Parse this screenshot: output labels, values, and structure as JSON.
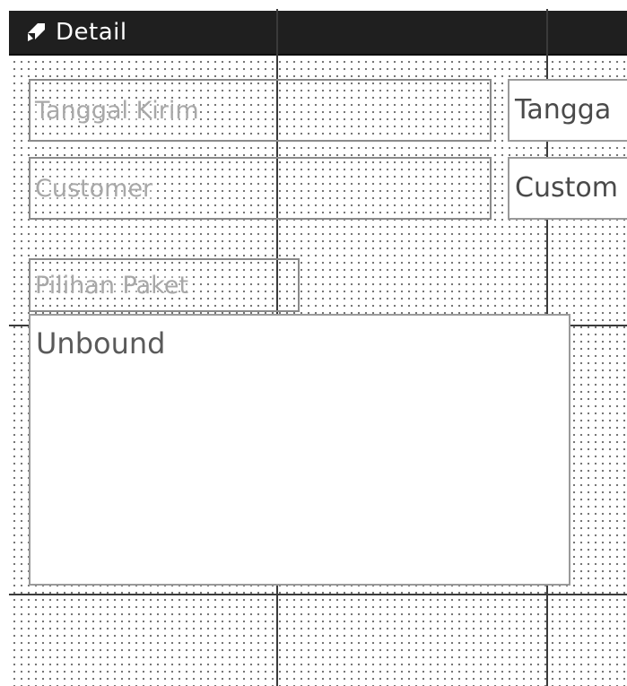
{
  "section": {
    "title": "Detail",
    "icon": "section-collapse-icon",
    "bar_color": "#1f1f1f"
  },
  "controls": {
    "tanggal_kirim_label": "Tanggal Kirim",
    "tanggal_kirim_field": "Tangga",
    "customer_label": "Customer",
    "customer_field": "Custom",
    "pilihan_paket_label": "Pilihan Paket",
    "unbound_field": "Unbound"
  }
}
